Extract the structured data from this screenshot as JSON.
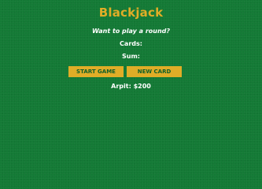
{
  "title": "Blackjack",
  "message": "Want to play a round?",
  "cards_label": "Cards:",
  "sum_label": "Sum:",
  "buttons": {
    "start_label": "START GAME",
    "new_card_label": "NEW CARD"
  },
  "player": {
    "text": "Arpit: $200"
  },
  "colors": {
    "table": "#137a35",
    "accent": "#e0ad27",
    "button_text": "#0f5f2a",
    "text": "#ffffff"
  }
}
